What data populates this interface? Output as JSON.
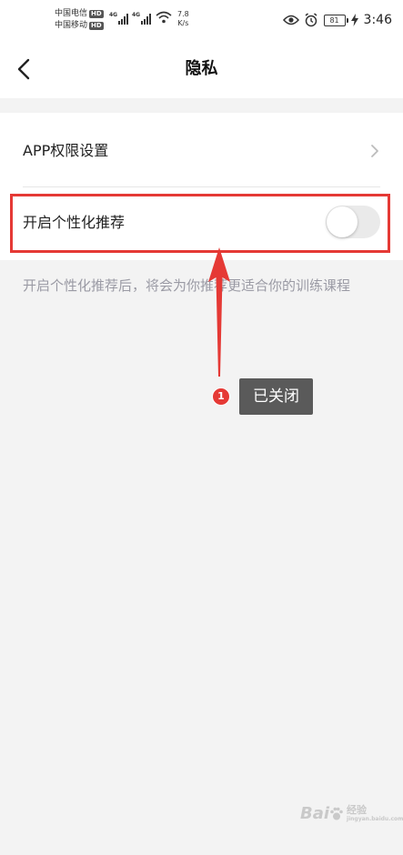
{
  "status_bar": {
    "carrier_1": "中国电信",
    "carrier_2": "中国移动",
    "hd_badge": "HD",
    "signal_1_label": "4G",
    "signal_2_label": "4G",
    "net_speed_value": "7.8",
    "net_speed_unit": "K/s",
    "battery_level": "81",
    "time": "3:46",
    "icons": [
      "wifi-icon",
      "eye-icon",
      "alarm-icon",
      "battery-icon",
      "charging-bolt-icon"
    ]
  },
  "nav": {
    "title": "隐私",
    "back_icon": "chevron-left-icon"
  },
  "settings": {
    "permissions_label": "APP权限设置",
    "permissions_icon": "chevron-right-icon",
    "recommend_label": "开启个性化推荐",
    "recommend_enabled": false,
    "description": "开启个性化推荐后，将会为你推荐更适合你的训练课程"
  },
  "annotation": {
    "step_number": "1",
    "callout_text": "已关闭",
    "color": "#e53935"
  },
  "watermark": {
    "logo_text": "Bai",
    "line_1": "经验",
    "line_2": "jingyan.baidu.com"
  },
  "colors": {
    "background": "#f3f3f3",
    "card": "#ffffff",
    "description_text": "#9a9aa4",
    "toggle_off": "#eaeaea"
  }
}
